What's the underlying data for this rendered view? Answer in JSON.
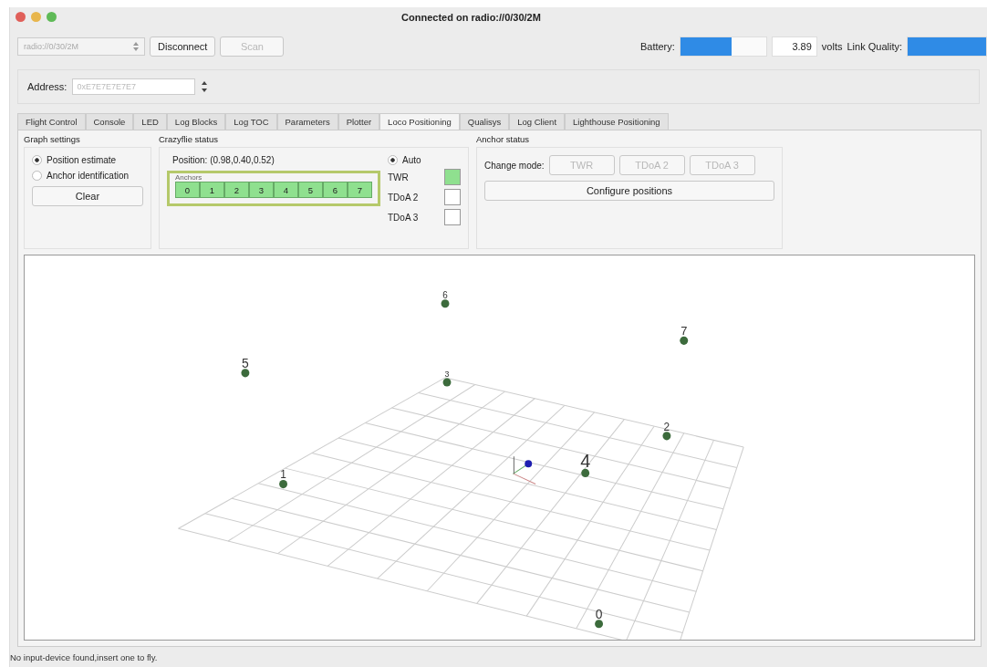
{
  "window": {
    "title": "Connected on radio://0/30/2M"
  },
  "toolbar": {
    "interface": "radio://0/30/2M",
    "connect_button": "Disconnect",
    "scan_button": "Scan",
    "battery_label": "Battery:",
    "battery": {
      "level": 0.6
    },
    "voltage": "3.89",
    "voltage_unit": "volts",
    "link_label": "Link Quality:",
    "link": {
      "level": 1
    }
  },
  "address": {
    "label": "Address:",
    "value": "0xE7E7E7E7E7"
  },
  "tabs": [
    {
      "label": "Flight Control",
      "selected": false
    },
    {
      "label": "Console",
      "selected": false
    },
    {
      "label": "LED",
      "selected": false
    },
    {
      "label": "Log Blocks",
      "selected": false
    },
    {
      "label": "Log TOC",
      "selected": false
    },
    {
      "label": "Parameters",
      "selected": false
    },
    {
      "label": "Plotter",
      "selected": false
    },
    {
      "label": "Loco Positioning",
      "selected": true
    },
    {
      "label": "Qualisys",
      "selected": false
    },
    {
      "label": "Log Client",
      "selected": false
    },
    {
      "label": "Lighthouse Positioning",
      "selected": false
    }
  ],
  "graph_settings": {
    "title": "Graph settings",
    "options": [
      {
        "label": "Position estimate",
        "selected": true
      },
      {
        "label": "Anchor identification",
        "selected": false
      }
    ],
    "clear_button": "Clear"
  },
  "crazyflie_status": {
    "title": "Crazyflie status",
    "position": "Position: (0.98,0.40,0.52)",
    "anchors_title": "Anchors",
    "anchors": [
      {
        "label": "0",
        "active": true
      },
      {
        "label": "1",
        "active": true
      },
      {
        "label": "2",
        "active": true
      },
      {
        "label": "3",
        "active": true
      },
      {
        "label": "4",
        "active": true
      },
      {
        "label": "5",
        "active": true
      },
      {
        "label": "6",
        "active": true
      },
      {
        "label": "7",
        "active": true
      }
    ],
    "auto": {
      "label": "Auto",
      "selected": true
    },
    "modes": [
      {
        "label": "TWR",
        "active": true
      },
      {
        "label": "TDoA 2",
        "active": false
      },
      {
        "label": "TDoA 3",
        "active": false
      }
    ]
  },
  "anchor_status": {
    "title": "Anchor status",
    "change_mode_label": "Change mode:",
    "mode_buttons": [
      {
        "label": "TWR",
        "disabled": true
      },
      {
        "label": "TDoA 2",
        "disabled": true
      },
      {
        "label": "TDoA 3",
        "disabled": true
      }
    ],
    "configure_button": "Configure positions"
  },
  "scene": {
    "anchors": [
      {
        "label": "0"
      },
      {
        "label": "1"
      },
      {
        "label": "2"
      },
      {
        "label": "3"
      },
      {
        "label": "4"
      },
      {
        "label": "5"
      },
      {
        "label": "6"
      },
      {
        "label": "7"
      }
    ]
  },
  "status_bar": "No input-device found,insert one to fly."
}
